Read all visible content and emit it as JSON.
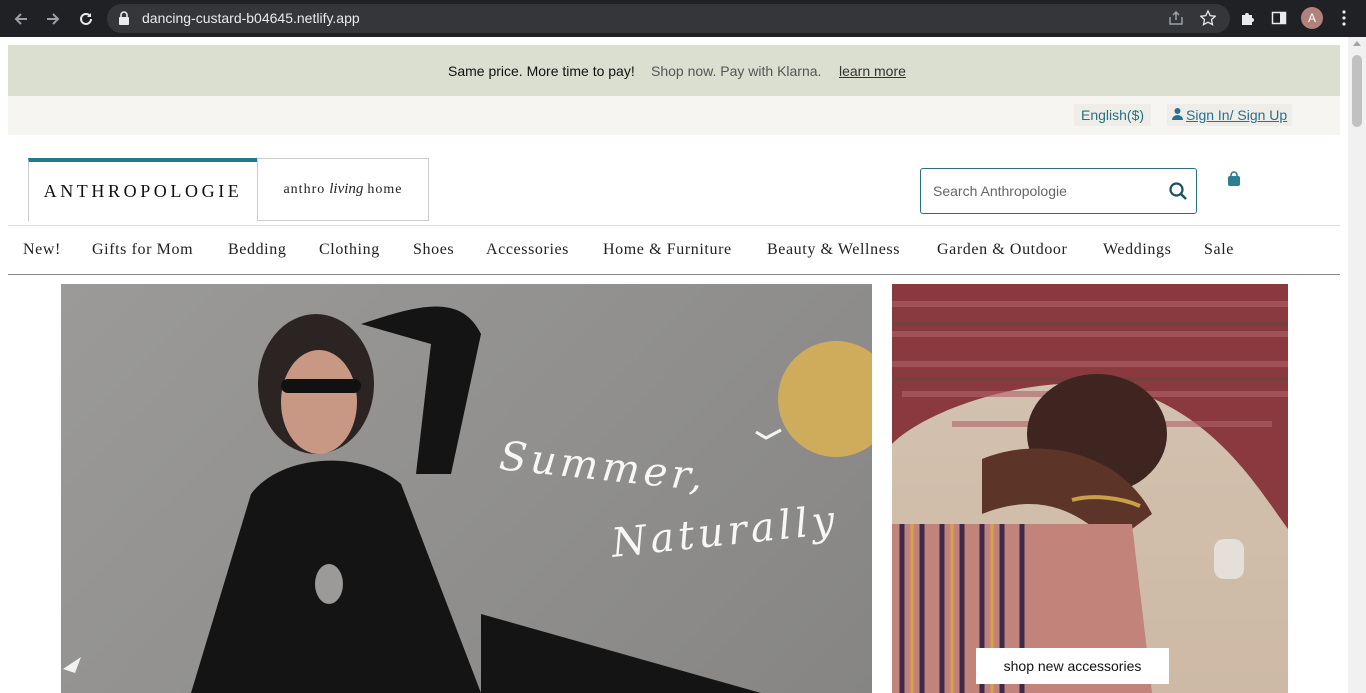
{
  "browser": {
    "url": "dancing-custard-b04645.netlify.app",
    "profile_initial": "A"
  },
  "promo": {
    "text1": "Same price. More time to pay!",
    "text2": "Shop now. Pay with Klarna.",
    "link": "learn more"
  },
  "utility": {
    "language": "English($)",
    "signin": "Sign In/ Sign Up"
  },
  "header": {
    "logo_main": "ANTHROPOLOGIE",
    "logo_home_left": "anthro",
    "logo_home_script": "living",
    "logo_home_right": "home",
    "search_placeholder": "Search Anthropologie"
  },
  "nav": {
    "items": [
      "New!",
      "Gifts for Mom",
      "Bedding",
      "Clothing",
      "Shoes",
      "Accessories",
      "Home & Furniture",
      "Beauty & Wellness",
      "Garden & Outdoor",
      "Weddings",
      "Sale"
    ]
  },
  "hero": {
    "script_line1": "Summer,",
    "script_line2": "Naturally",
    "side_cta": "shop new accessories"
  },
  "colors": {
    "accent": "#1f7a8c",
    "promo_bg": "#dbdfd0",
    "link": "#2a6f8f"
  }
}
